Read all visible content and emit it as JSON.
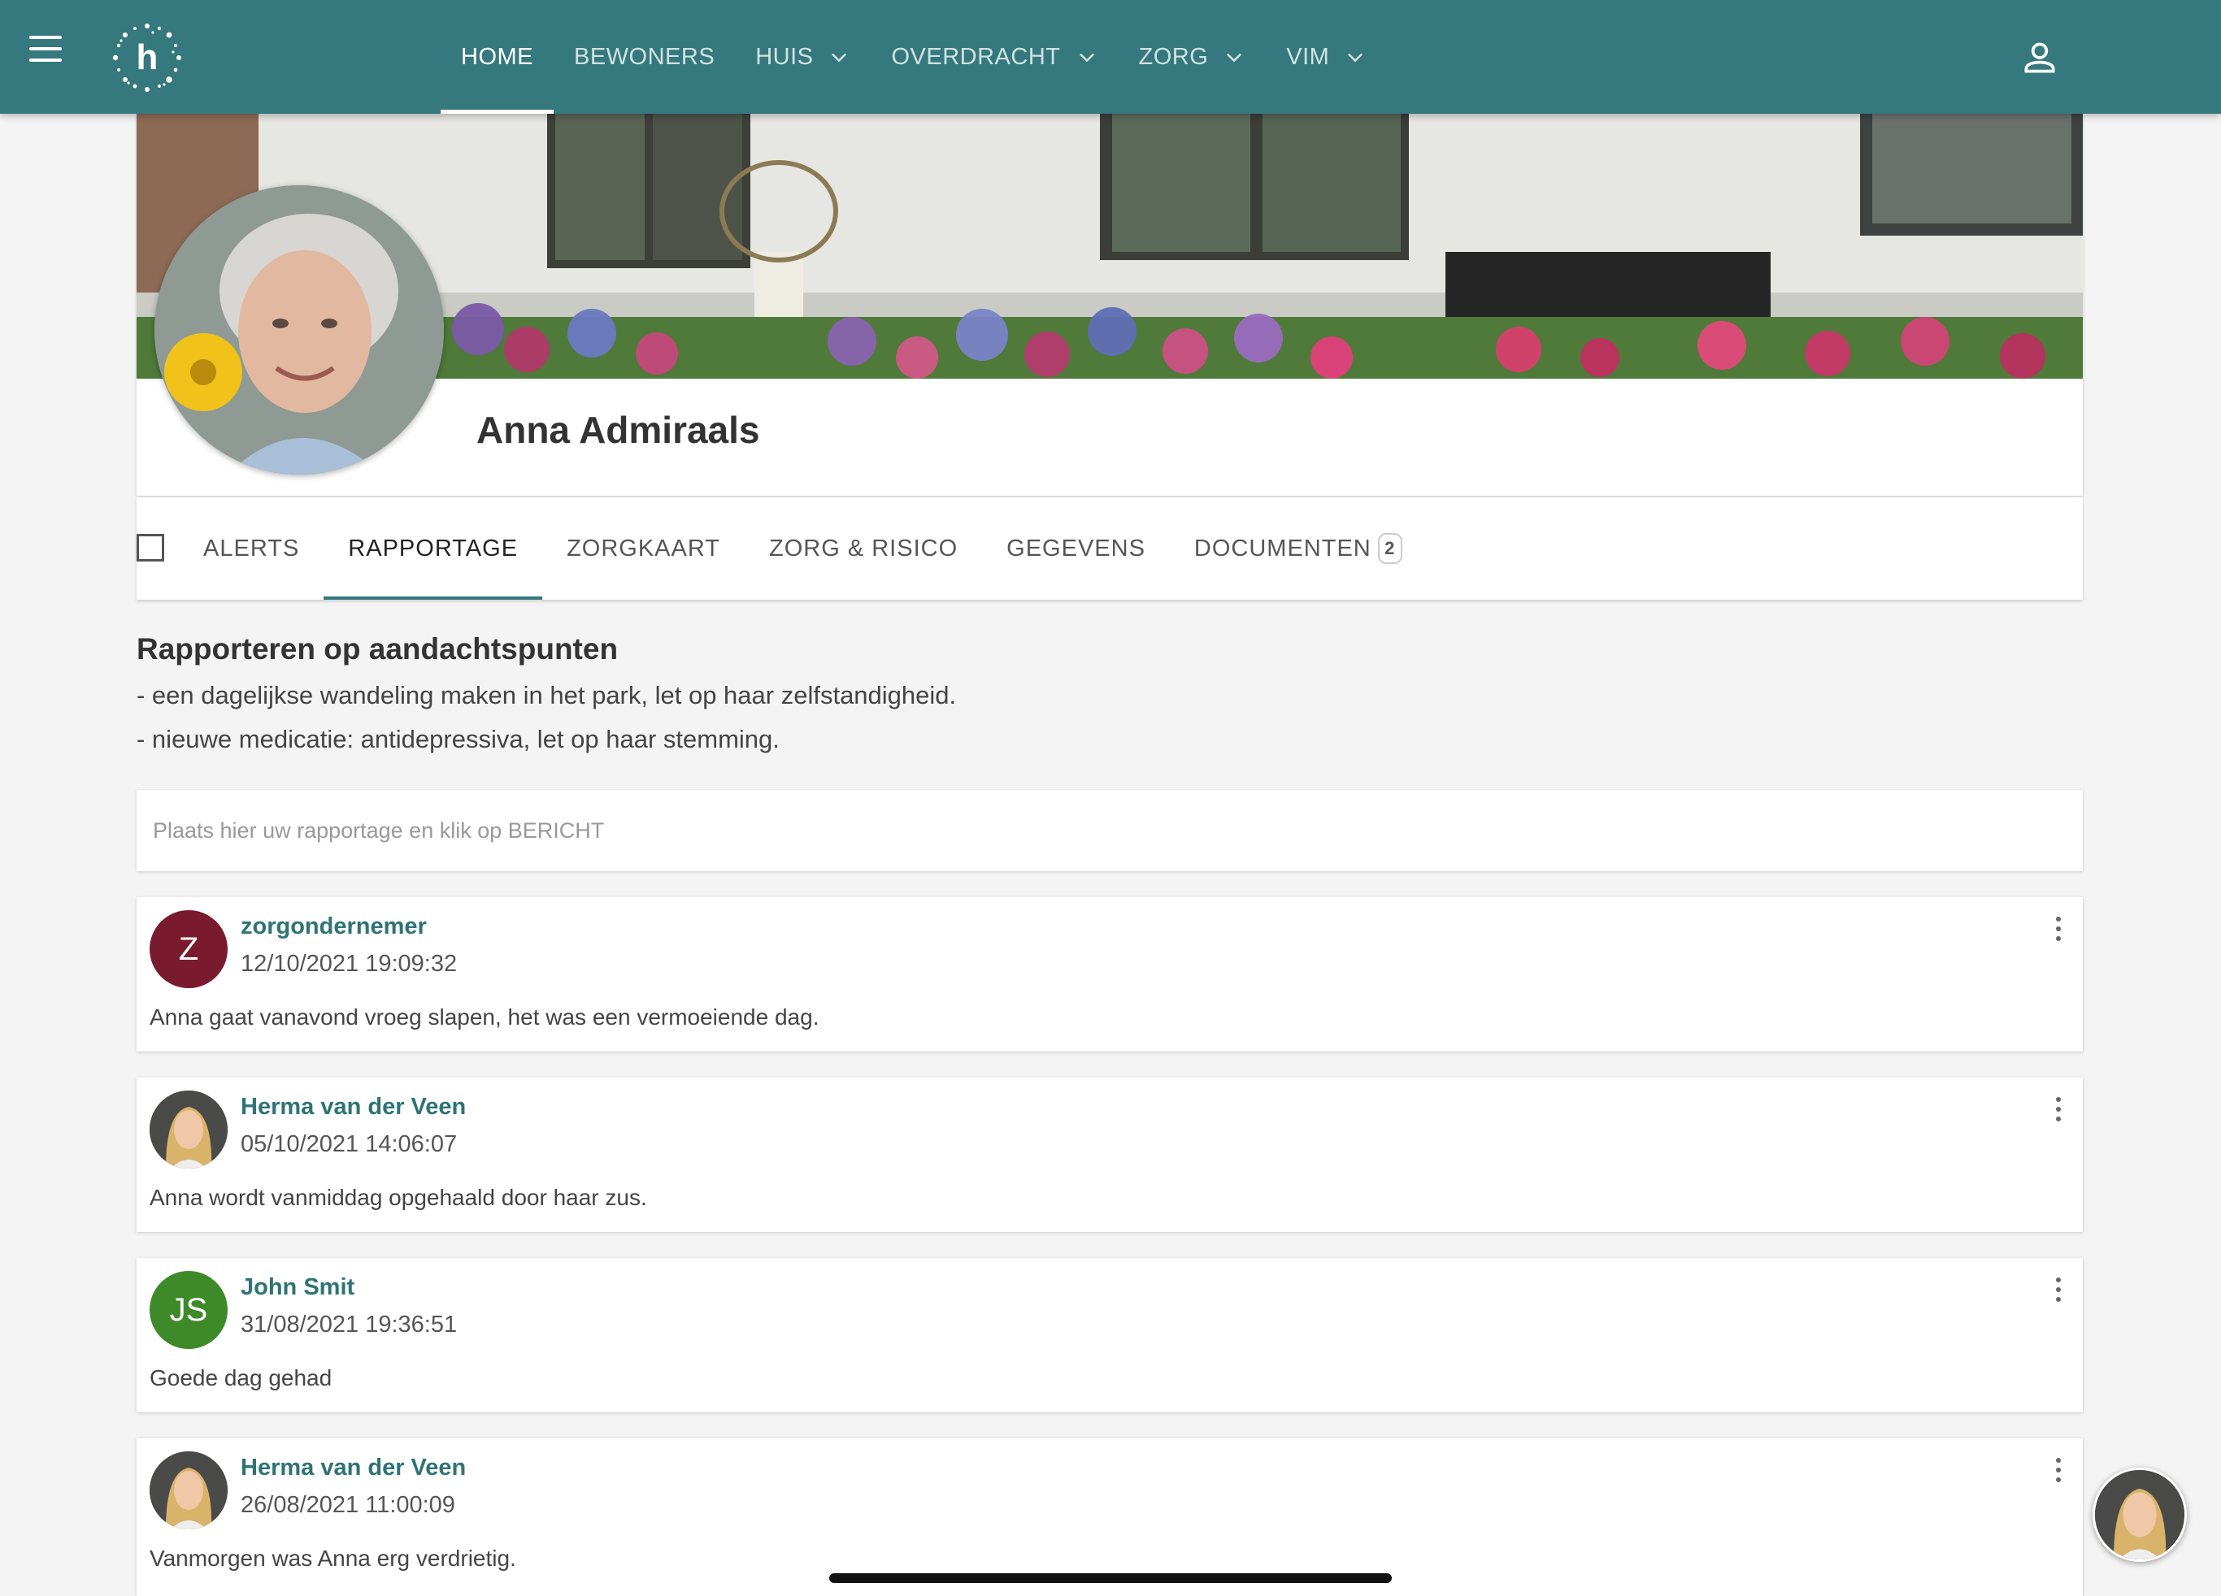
{
  "nav": {
    "items": [
      {
        "label": "HOME",
        "active": true,
        "dropdown": false
      },
      {
        "label": "BEWONERS",
        "active": false,
        "dropdown": false
      },
      {
        "label": "HUIS",
        "active": false,
        "dropdown": true
      },
      {
        "label": "OVERDRACHT",
        "active": false,
        "dropdown": true
      },
      {
        "label": "ZORG",
        "active": false,
        "dropdown": true
      },
      {
        "label": "VIM",
        "active": false,
        "dropdown": true
      }
    ],
    "logo_letter": "h"
  },
  "resident": {
    "name": "Anna Admiraals"
  },
  "tabs": [
    {
      "label": "ALERTS",
      "active": false
    },
    {
      "label": "RAPPORTAGE",
      "active": true
    },
    {
      "label": "ZORGKAART",
      "active": false
    },
    {
      "label": "ZORG & RISICO",
      "active": false
    },
    {
      "label": "GEGEVENS",
      "active": false
    },
    {
      "label": "DOCUMENTEN",
      "active": false,
      "badge": "2"
    }
  ],
  "attention": {
    "title": "Rapporteren op aandachtspunten",
    "points": [
      "- een dagelijkse wandeling maken in het park, let op haar zelfstandigheid.",
      "- nieuwe medicatie: antidepressiva, let op haar stemming."
    ]
  },
  "report_input": {
    "placeholder": "Plaats hier uw rapportage en klik op BERICHT"
  },
  "reports": [
    {
      "author": "zorgondernemer",
      "date": "12/10/2021 19:09:32",
      "text": "Anna gaat vanavond vroeg slapen, het was een vermoeiende dag.",
      "avatar_initials": "Z",
      "avatar_color": "#7a1a2e",
      "avatar_photo": false
    },
    {
      "author": "Herma van der Veen",
      "date": "05/10/2021 14:06:07",
      "text": "Anna wordt vanmiddag opgehaald door haar zus.",
      "avatar_initials": "",
      "avatar_color": "#4a4a48",
      "avatar_photo": true
    },
    {
      "author": "John Smit",
      "date": "31/08/2021 19:36:51",
      "text": "Goede dag gehad",
      "avatar_initials": "JS",
      "avatar_color": "#3e8a2a",
      "avatar_photo": false
    },
    {
      "author": "Herma van der Veen",
      "date": "26/08/2021 11:00:09",
      "text": "Vanmorgen was Anna erg verdrietig.",
      "avatar_initials": "",
      "avatar_color": "#4a4a48",
      "avatar_photo": true
    }
  ],
  "colors": {
    "topbar": "#35787d",
    "author_link": "#2f7375",
    "tab_underline": "#35787d"
  }
}
